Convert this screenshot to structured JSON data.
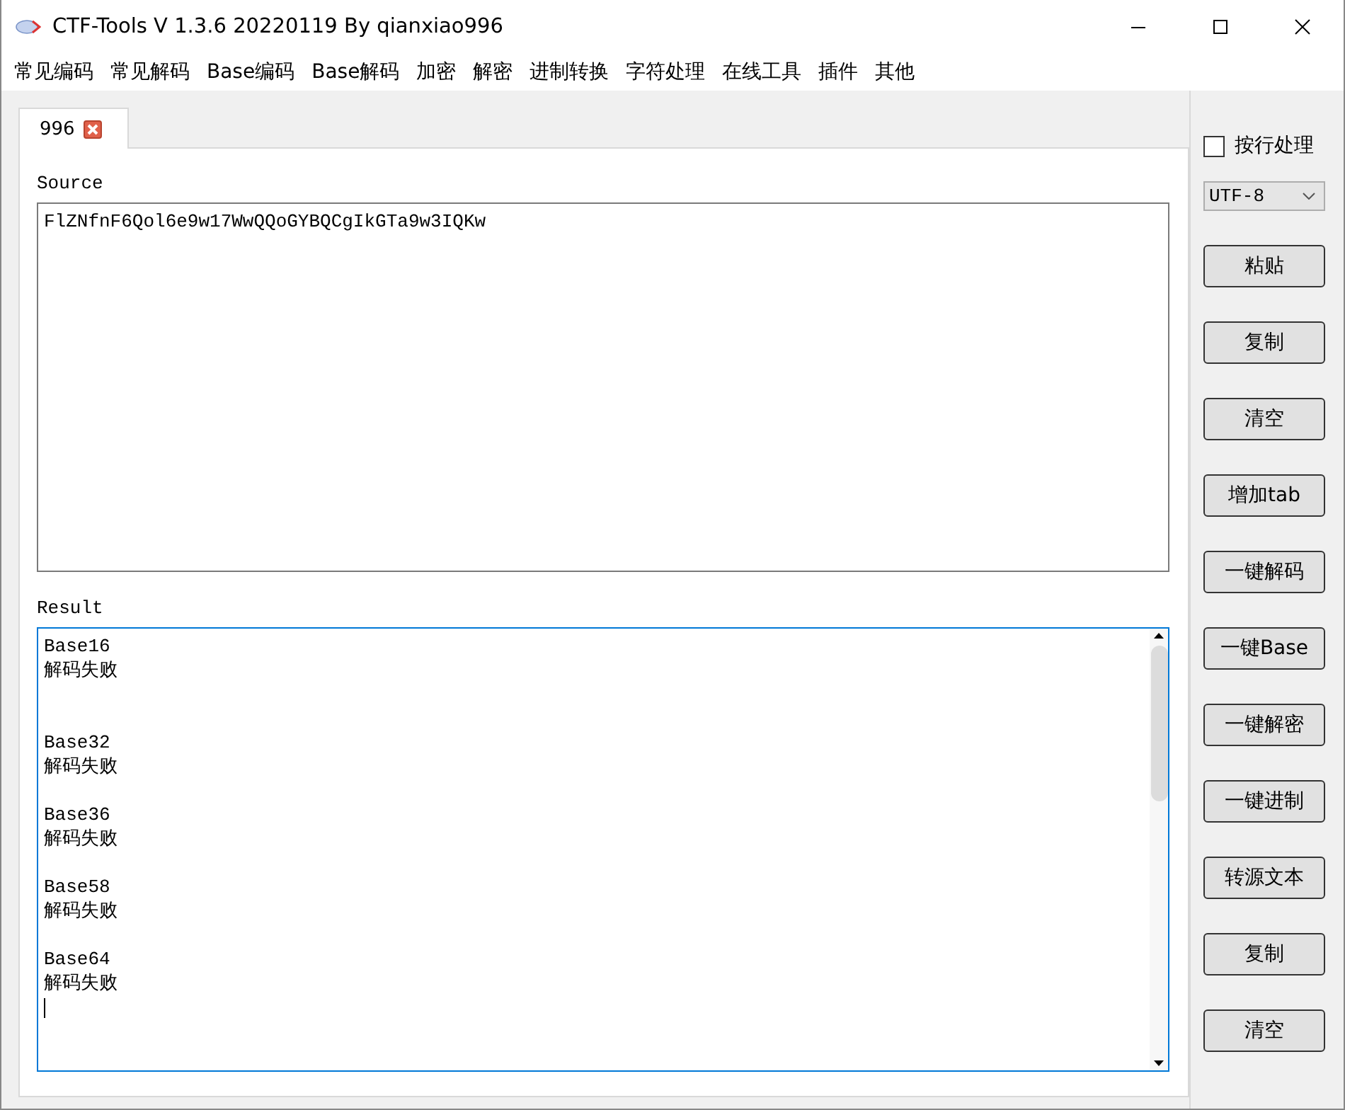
{
  "window": {
    "title": "CTF-Tools V 1.3.6 20220119 By qianxiao996"
  },
  "menu": [
    "常见编码",
    "常见解码",
    "Base编码",
    "Base解码",
    "加密",
    "解密",
    "进制转换",
    "字符处理",
    "在线工具",
    "插件",
    "其他"
  ],
  "tabs": [
    {
      "label": "996",
      "selected": true
    }
  ],
  "source": {
    "label": "Source",
    "value": "FlZNfnF6Qol6e9w17WwQQoGYBQCgIkGTa9w3IQKw"
  },
  "result": {
    "label": "Result",
    "value": "Base16\n解码失败\n\n\nBase32\n解码失败\n\nBase36\n解码失败\n\nBase58\n解码失败\n\nBase64\n解码失败"
  },
  "line_mode": {
    "label": "按行处理",
    "checked": false
  },
  "encoding": {
    "value": "UTF-8"
  },
  "buttons": [
    "粘贴",
    "复制",
    "清空",
    "增加tab",
    "一键解码",
    "一键Base",
    "一键解密",
    "一键进制",
    "转源文本",
    "复制",
    "清空"
  ]
}
